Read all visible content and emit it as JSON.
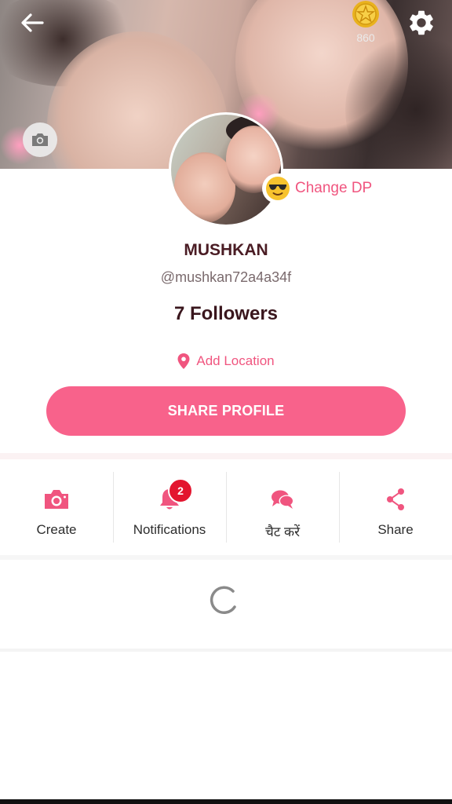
{
  "header": {
    "back_icon": "arrow-left-icon",
    "settings_icon": "gear-icon",
    "coin_icon": "coin-icon",
    "coin_count": "860",
    "cover_camera_icon": "camera-icon"
  },
  "profile": {
    "change_dp_emoji": "sunglasses-emoji-icon",
    "change_dp_label": "Change DP",
    "name": "MUSHKAN",
    "handle": "@mushkan72a4a34f",
    "followers": "7 Followers",
    "location_icon": "location-pin-icon",
    "location_label": "Add Location",
    "share_profile_label": "SHARE PROFILE"
  },
  "actions": [
    {
      "label": "Create",
      "icon": "camera-icon"
    },
    {
      "label": "Notifications",
      "icon": "bell-icon",
      "badge": "2"
    },
    {
      "label": "चैट करें",
      "icon": "chat-bubbles-icon"
    },
    {
      "label": "Share",
      "icon": "share-icon"
    }
  ],
  "colors": {
    "accent": "#f8628b",
    "accent_text": "#f0557f",
    "badge": "#e3152f",
    "name_text": "#4a1c24"
  },
  "loading": {
    "icon": "loading-spinner-icon"
  }
}
